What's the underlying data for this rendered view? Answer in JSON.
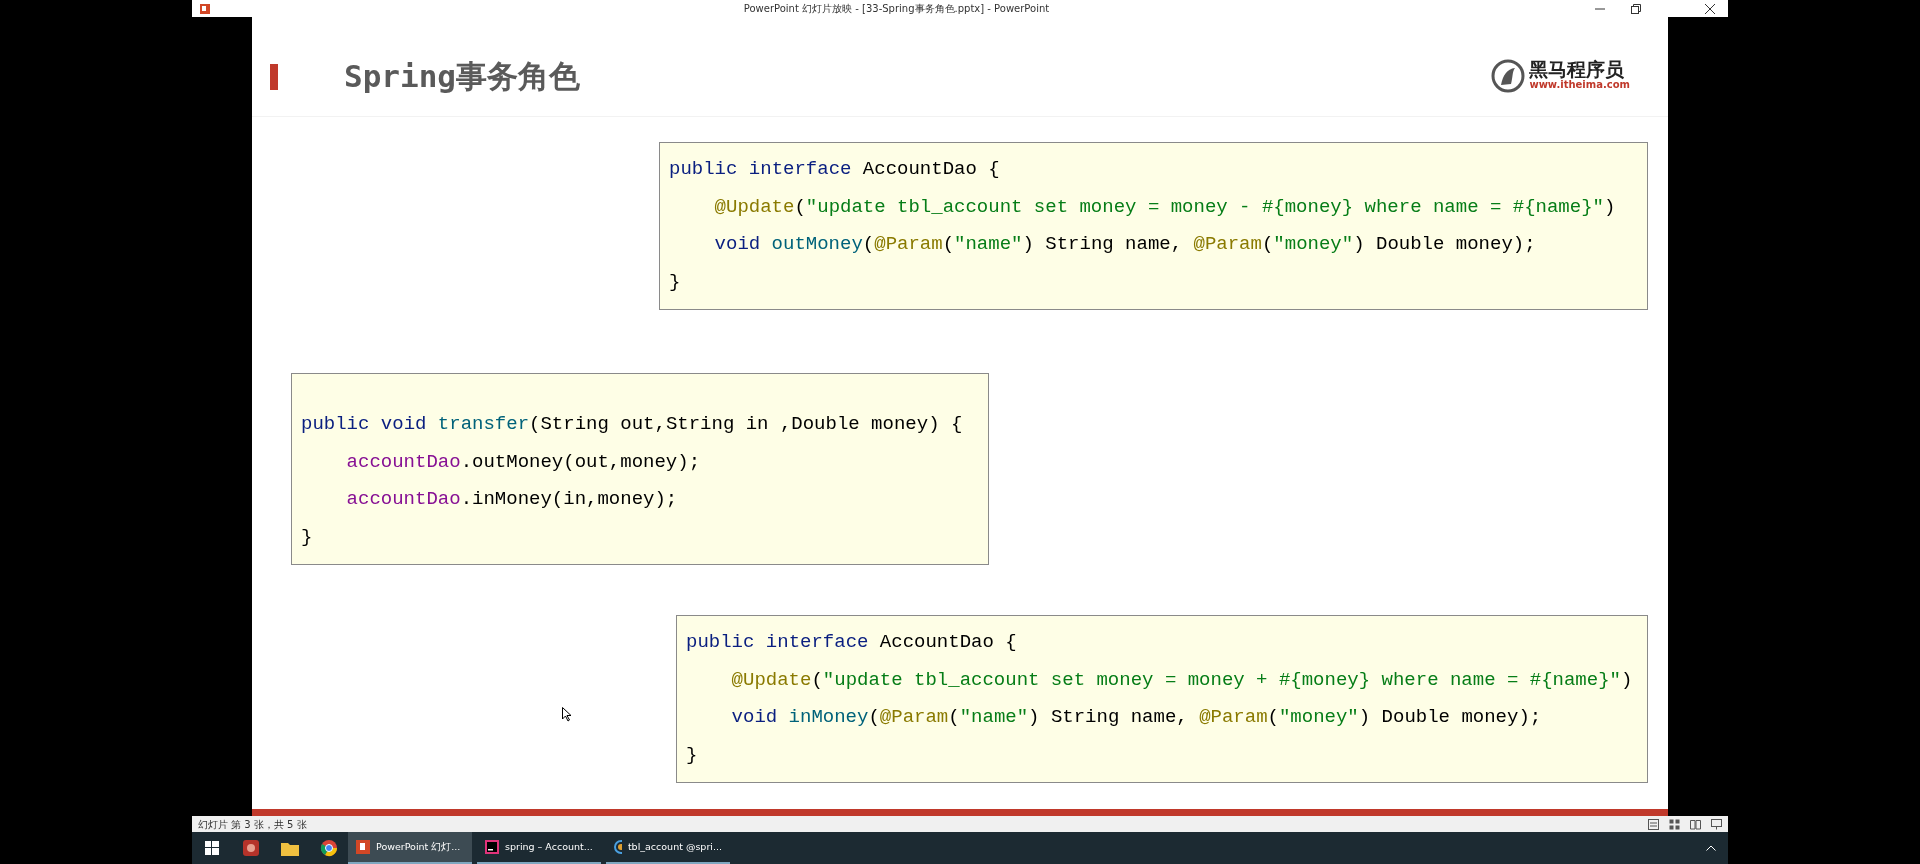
{
  "window": {
    "title": "PowerPoint 幻灯片放映 - [33-Spring事务角色.pptx] - PowerPoint"
  },
  "slide": {
    "title": "Spring事务角色",
    "logo": {
      "name": "黑马程序员",
      "url": "www.itheima.com"
    },
    "code_blocks": [
      {
        "lines": [
          {
            "indented": false,
            "tokens": [
              {
                "kind": "keyword",
                "text": "public "
              },
              {
                "kind": "keyword",
                "text": "interface"
              },
              {
                "kind": "plain",
                "text": " AccountDao {"
              }
            ]
          },
          {
            "indented": true,
            "tokens": [
              {
                "kind": "annotation",
                "text": "@Update"
              },
              {
                "kind": "plain",
                "text": "("
              },
              {
                "kind": "string",
                "text": "\"update tbl_account set money = money - #{money} where name = #{name}\""
              },
              {
                "kind": "plain",
                "text": ")"
              }
            ]
          },
          {
            "indented": true,
            "tokens": [
              {
                "kind": "keyword",
                "text": "void "
              },
              {
                "kind": "method",
                "text": "outMoney"
              },
              {
                "kind": "plain",
                "text": "("
              },
              {
                "kind": "annotation",
                "text": "@Param"
              },
              {
                "kind": "plain",
                "text": "("
              },
              {
                "kind": "string",
                "text": "\"name\""
              },
              {
                "kind": "plain",
                "text": ") String name, "
              },
              {
                "kind": "annotation",
                "text": "@Param"
              },
              {
                "kind": "plain",
                "text": "("
              },
              {
                "kind": "string",
                "text": "\"money\""
              },
              {
                "kind": "plain",
                "text": ") Double money);"
              }
            ]
          },
          {
            "indented": false,
            "tokens": [
              {
                "kind": "plain",
                "text": "}"
              }
            ]
          }
        ]
      },
      {
        "lines": [
          {
            "indented": false,
            "tokens": [
              {
                "kind": "keyword",
                "text": "public "
              },
              {
                "kind": "keyword",
                "text": "void "
              },
              {
                "kind": "method",
                "text": "transfer"
              },
              {
                "kind": "plain",
                "text": "(String out,String in ,Double money) {"
              }
            ]
          },
          {
            "indented": true,
            "tokens": [
              {
                "kind": "field",
                "text": "accountDao"
              },
              {
                "kind": "plain",
                "text": ".outMoney(out,money);"
              }
            ]
          },
          {
            "indented": true,
            "tokens": [
              {
                "kind": "field",
                "text": "accountDao"
              },
              {
                "kind": "plain",
                "text": ".inMoney(in,money);"
              }
            ]
          },
          {
            "indented": false,
            "tokens": [
              {
                "kind": "plain",
                "text": "}"
              }
            ]
          }
        ]
      },
      {
        "lines": [
          {
            "indented": false,
            "tokens": [
              {
                "kind": "keyword",
                "text": "public "
              },
              {
                "kind": "keyword",
                "text": "interface"
              },
              {
                "kind": "plain",
                "text": " AccountDao {"
              }
            ]
          },
          {
            "indented": true,
            "tokens": [
              {
                "kind": "annotation",
                "text": "@Update"
              },
              {
                "kind": "plain",
                "text": "("
              },
              {
                "kind": "string",
                "text": "\"update tbl_account set money = money + #{money} where name = #{name}\""
              },
              {
                "kind": "plain",
                "text": ")"
              }
            ]
          },
          {
            "indented": true,
            "tokens": [
              {
                "kind": "keyword",
                "text": "void "
              },
              {
                "kind": "method",
                "text": "inMoney"
              },
              {
                "kind": "plain",
                "text": "("
              },
              {
                "kind": "annotation",
                "text": "@Param"
              },
              {
                "kind": "plain",
                "text": "("
              },
              {
                "kind": "string",
                "text": "\"name\""
              },
              {
                "kind": "plain",
                "text": ") String name, "
              },
              {
                "kind": "annotation",
                "text": "@Param"
              },
              {
                "kind": "plain",
                "text": "("
              },
              {
                "kind": "string",
                "text": "\"money\""
              },
              {
                "kind": "plain",
                "text": ") Double money);"
              }
            ]
          },
          {
            "indented": false,
            "tokens": [
              {
                "kind": "plain",
                "text": "}"
              }
            ]
          }
        ]
      }
    ]
  },
  "status_bar": {
    "text": "幻灯片 第 3 张，共 5 张"
  },
  "taskbar": {
    "buttons": [
      {
        "label": "PowerPoint 幻灯...",
        "kind": "powerpoint",
        "selected": true
      },
      {
        "label": "spring – Account...",
        "kind": "ide",
        "selected": false
      },
      {
        "label": "tbl_account @spri...",
        "kind": "database",
        "selected": false
      }
    ]
  }
}
